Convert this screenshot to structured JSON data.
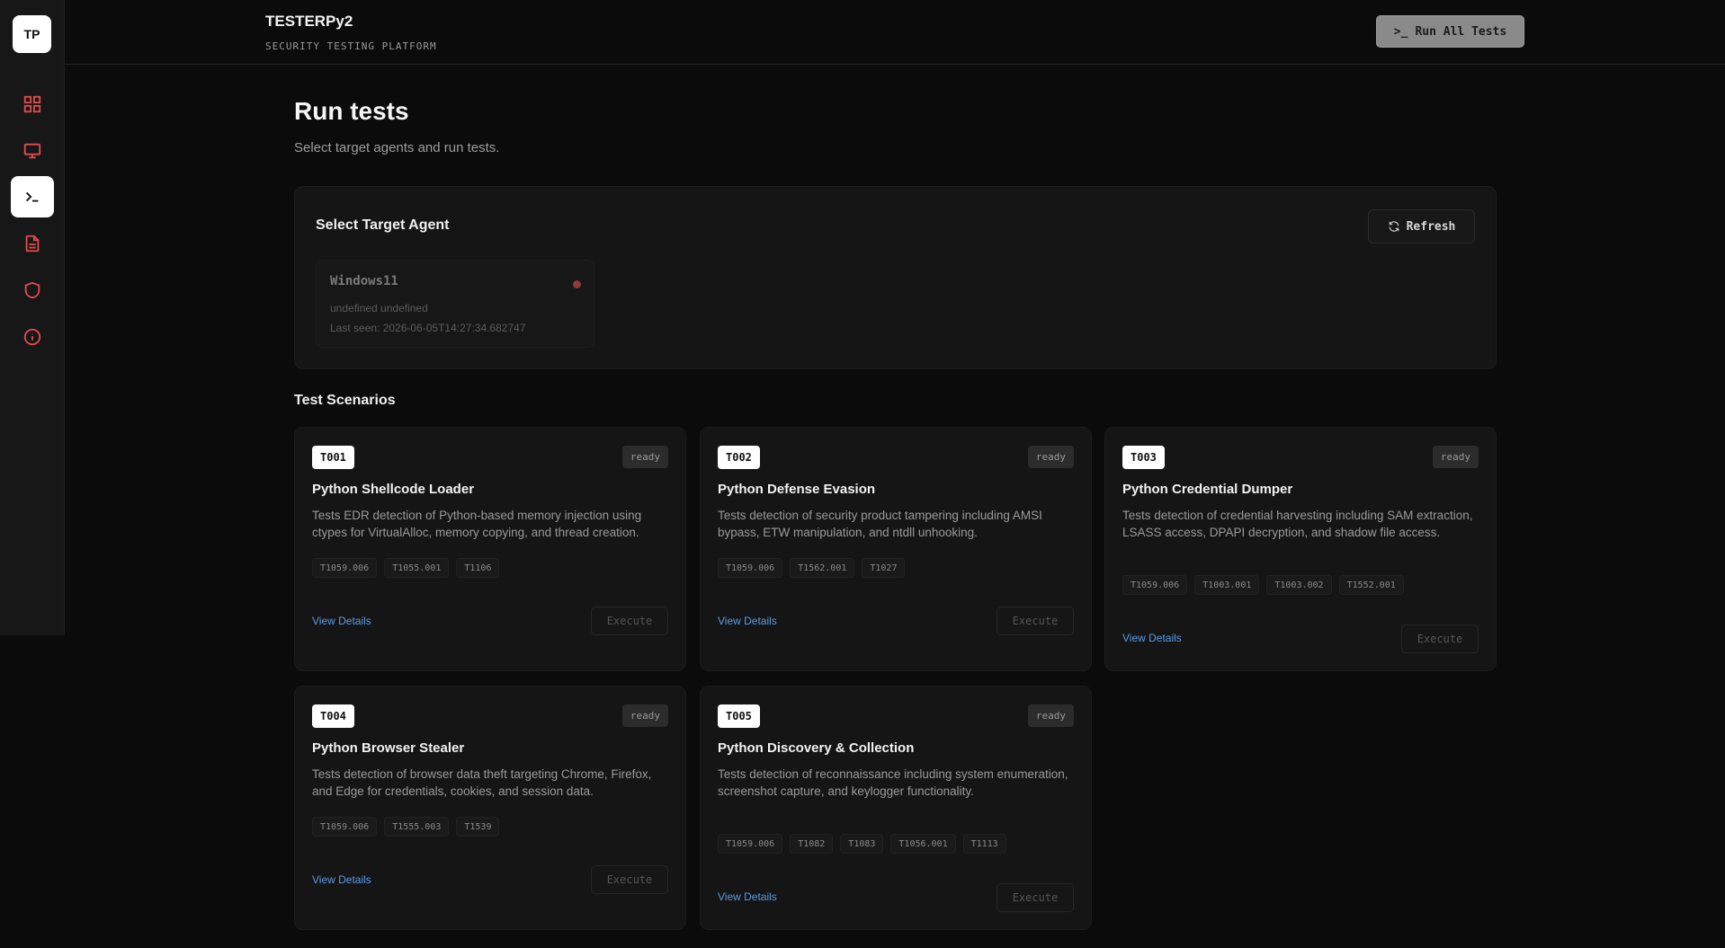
{
  "sidebar": {
    "logo": "TP",
    "items": [
      {
        "name": "dashboard-icon"
      },
      {
        "name": "monitor-icon"
      },
      {
        "name": "terminal-icon"
      },
      {
        "name": "document-icon"
      },
      {
        "name": "shield-icon"
      },
      {
        "name": "info-icon"
      }
    ],
    "active_index": 2,
    "icon_color": "#e24b4b"
  },
  "header": {
    "title": "TESTERPy2",
    "subtitle": "SECURITY TESTING PLATFORM",
    "run_all_label": "Run All Tests",
    "run_all_icon": ">_"
  },
  "page": {
    "title": "Run tests",
    "description": "Select target agents and run tests."
  },
  "agents_panel": {
    "title": "Select Target Agent",
    "refresh_label": "Refresh",
    "agents": [
      {
        "name": "Windows11",
        "os": "undefined undefined",
        "last_seen": "Last seen: 2026-06-05T14:27:34.682747",
        "status_color": "#8e3a3a"
      }
    ]
  },
  "scenarios": {
    "title": "Test Scenarios",
    "view_label": "View Details",
    "execute_label": "Execute",
    "items": [
      {
        "id": "T001",
        "status": "ready",
        "title": "Python Shellcode Loader",
        "description": "Tests EDR detection of Python-based memory injection using ctypes for VirtualAlloc, memory copying, and thread creation.",
        "tags": [
          "T1059.006",
          "T1055.001",
          "T1106"
        ]
      },
      {
        "id": "T002",
        "status": "ready",
        "title": "Python Defense Evasion",
        "description": "Tests detection of security product tampering including AMSI bypass, ETW manipulation, and ntdll unhooking.",
        "tags": [
          "T1059.006",
          "T1562.001",
          "T1027"
        ]
      },
      {
        "id": "T003",
        "status": "ready",
        "title": "Python Credential Dumper",
        "description": "Tests detection of credential harvesting including SAM extraction, LSASS access, DPAPI decryption, and shadow file access.",
        "tags": [
          "T1059.006",
          "T1003.001",
          "T1003.002",
          "T1552.001"
        ]
      },
      {
        "id": "T004",
        "status": "ready",
        "title": "Python Browser Stealer",
        "description": "Tests detection of browser data theft targeting Chrome, Firefox, and Edge for credentials, cookies, and session data.",
        "tags": [
          "T1059.006",
          "T1555.003",
          "T1539"
        ]
      },
      {
        "id": "T005",
        "status": "ready",
        "title": "Python Discovery & Collection",
        "description": "Tests detection of reconnaissance including system enumeration, screenshot capture, and keylogger functionality.",
        "tags": [
          "T1059.006",
          "T1082",
          "T1083",
          "T1056.001",
          "T1113"
        ]
      }
    ]
  }
}
